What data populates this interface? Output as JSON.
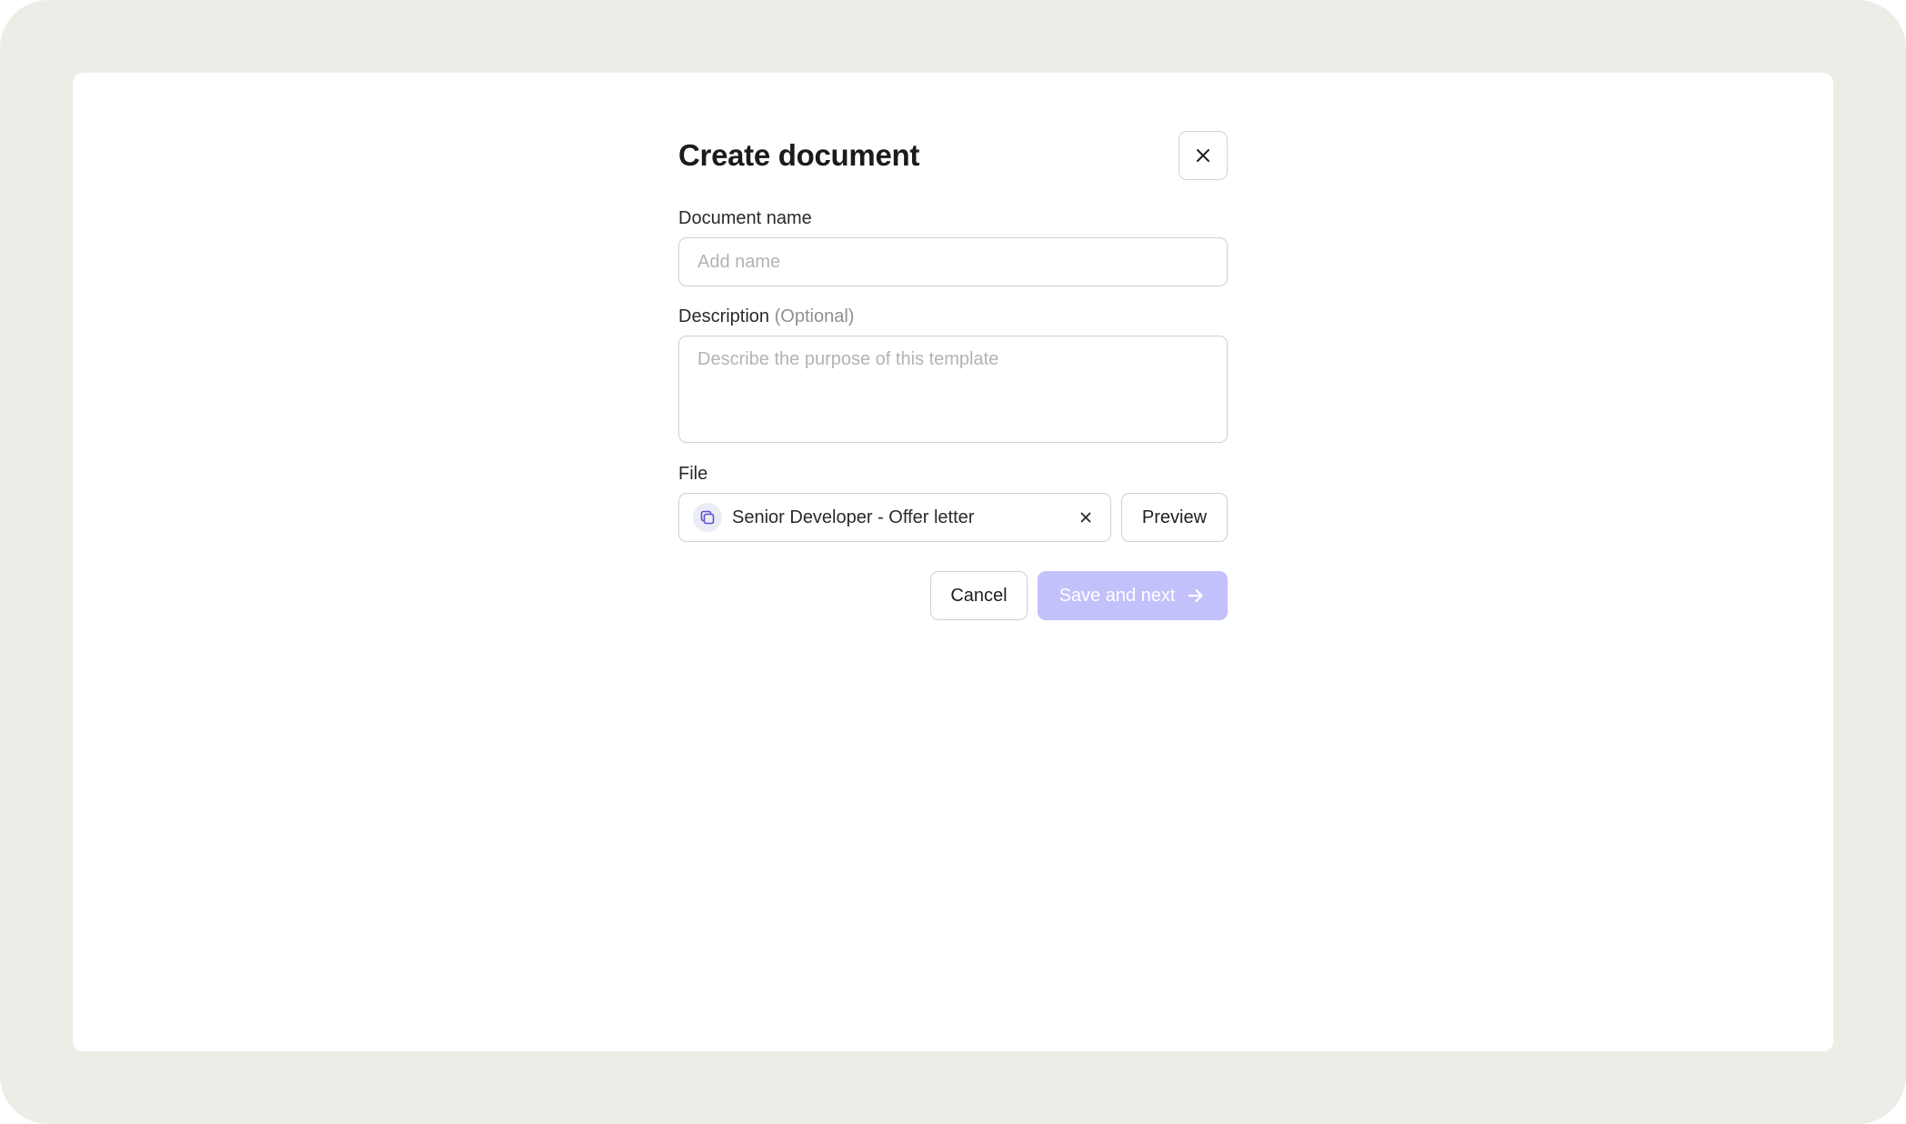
{
  "dialog": {
    "title": "Create document",
    "close_icon": "close-icon"
  },
  "fields": {
    "name": {
      "label": "Document name",
      "placeholder": "Add name",
      "value": ""
    },
    "description": {
      "label": "Description",
      "optional_tag": "(Optional)",
      "placeholder": "Describe the purpose of this template",
      "value": ""
    },
    "file": {
      "label": "File",
      "file_name": "Senior Developer - Offer letter",
      "file_icon": "document-copy-icon",
      "remove_icon": "close-icon",
      "preview_label": "Preview"
    }
  },
  "actions": {
    "cancel_label": "Cancel",
    "save_label": "Save and next",
    "save_icon": "arrow-right-icon"
  },
  "colors": {
    "background": "#edede8",
    "card": "#ffffff",
    "primary_disabled": "#c3c1fb",
    "file_icon_accent": "#5b56d6",
    "border": "#cfcfcf"
  }
}
